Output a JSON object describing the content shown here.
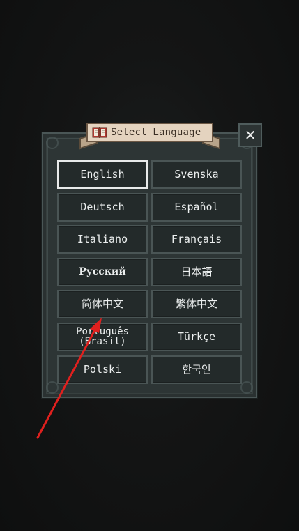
{
  "dialog": {
    "title": "Select Language",
    "title_icon": "book-icon",
    "close_label": "✕",
    "close_icon": "close-icon"
  },
  "languages": [
    {
      "label": "English",
      "selected": true
    },
    {
      "label": "Svenska"
    },
    {
      "label": "Deutsch"
    },
    {
      "label": "Español"
    },
    {
      "label": "Italiano"
    },
    {
      "label": "Français"
    },
    {
      "label": "Русский"
    },
    {
      "label": "日本語"
    },
    {
      "label": "简体中文"
    },
    {
      "label": "繁体中文"
    },
    {
      "label": "Português\n(Brasil)"
    },
    {
      "label": "Türkçe"
    },
    {
      "label": "Polski"
    },
    {
      "label": "한국인"
    }
  ],
  "colors": {
    "background": "#141515",
    "panel": "#2d3535",
    "button_bg": "#232a2a",
    "button_border": "#4a5555",
    "selected_border": "#e8eaea",
    "title_plate": "#e4d3bf",
    "arrow": "#e0201e"
  }
}
